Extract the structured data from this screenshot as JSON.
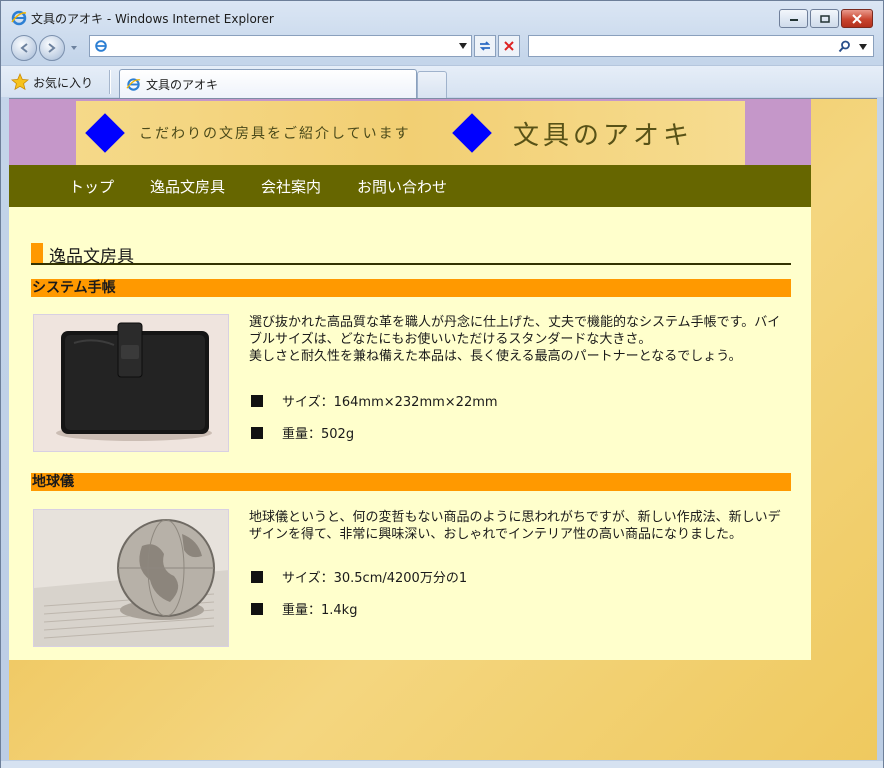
{
  "window": {
    "title": "文具のアオキ - Windows Internet Explorer",
    "controls": {
      "minimize": "minimize",
      "maximize": "maximize",
      "close": "close"
    }
  },
  "address_bar": {
    "value": ""
  },
  "search_bar": {
    "value": ""
  },
  "favorites": {
    "label": "お気に入り"
  },
  "tab": {
    "label": "文具のアオキ"
  },
  "site": {
    "tagline": "こだわりの文房具をご紹介しています",
    "logo": "文具のアオキ",
    "nav": [
      "トップ",
      "逸品文房具",
      "会社案内",
      "お問い合わせ"
    ],
    "section_title": "逸品文房具",
    "products": [
      {
        "name": "システム手帳",
        "image": "black-leather-planner",
        "description": "選び抜かれた高品質な革を職人が丹念に仕上げた、丈夫で機能的なシステム手帳です。バイブルサイズは、どなたにもお使いいただけるスタンダードな大きさ。\n美しさと耐久性を兼ね備えた本品は、長く使える最高のパートナーとなるでしょう。",
        "specs": [
          "サイズ：164mm×232mm×22mm",
          "重量：502g"
        ]
      },
      {
        "name": "地球儀",
        "image": "globe-on-newspaper",
        "description": "地球儀というと、何の変哲もない商品のように思われがちですが、新しい作成法、新しいデザインを得て、非常に興味深い、おしゃれでインテリア性の高い商品になりました。",
        "specs": [
          "サイズ：30.5cm/4200万分の1",
          "重量：1.4kg"
        ]
      }
    ]
  },
  "colors": {
    "banner_side": "#c597c9",
    "nav_bg": "#666600",
    "accent": "#ff9900",
    "content_bg": "#ffffcc",
    "diamond": "#0000ff"
  }
}
